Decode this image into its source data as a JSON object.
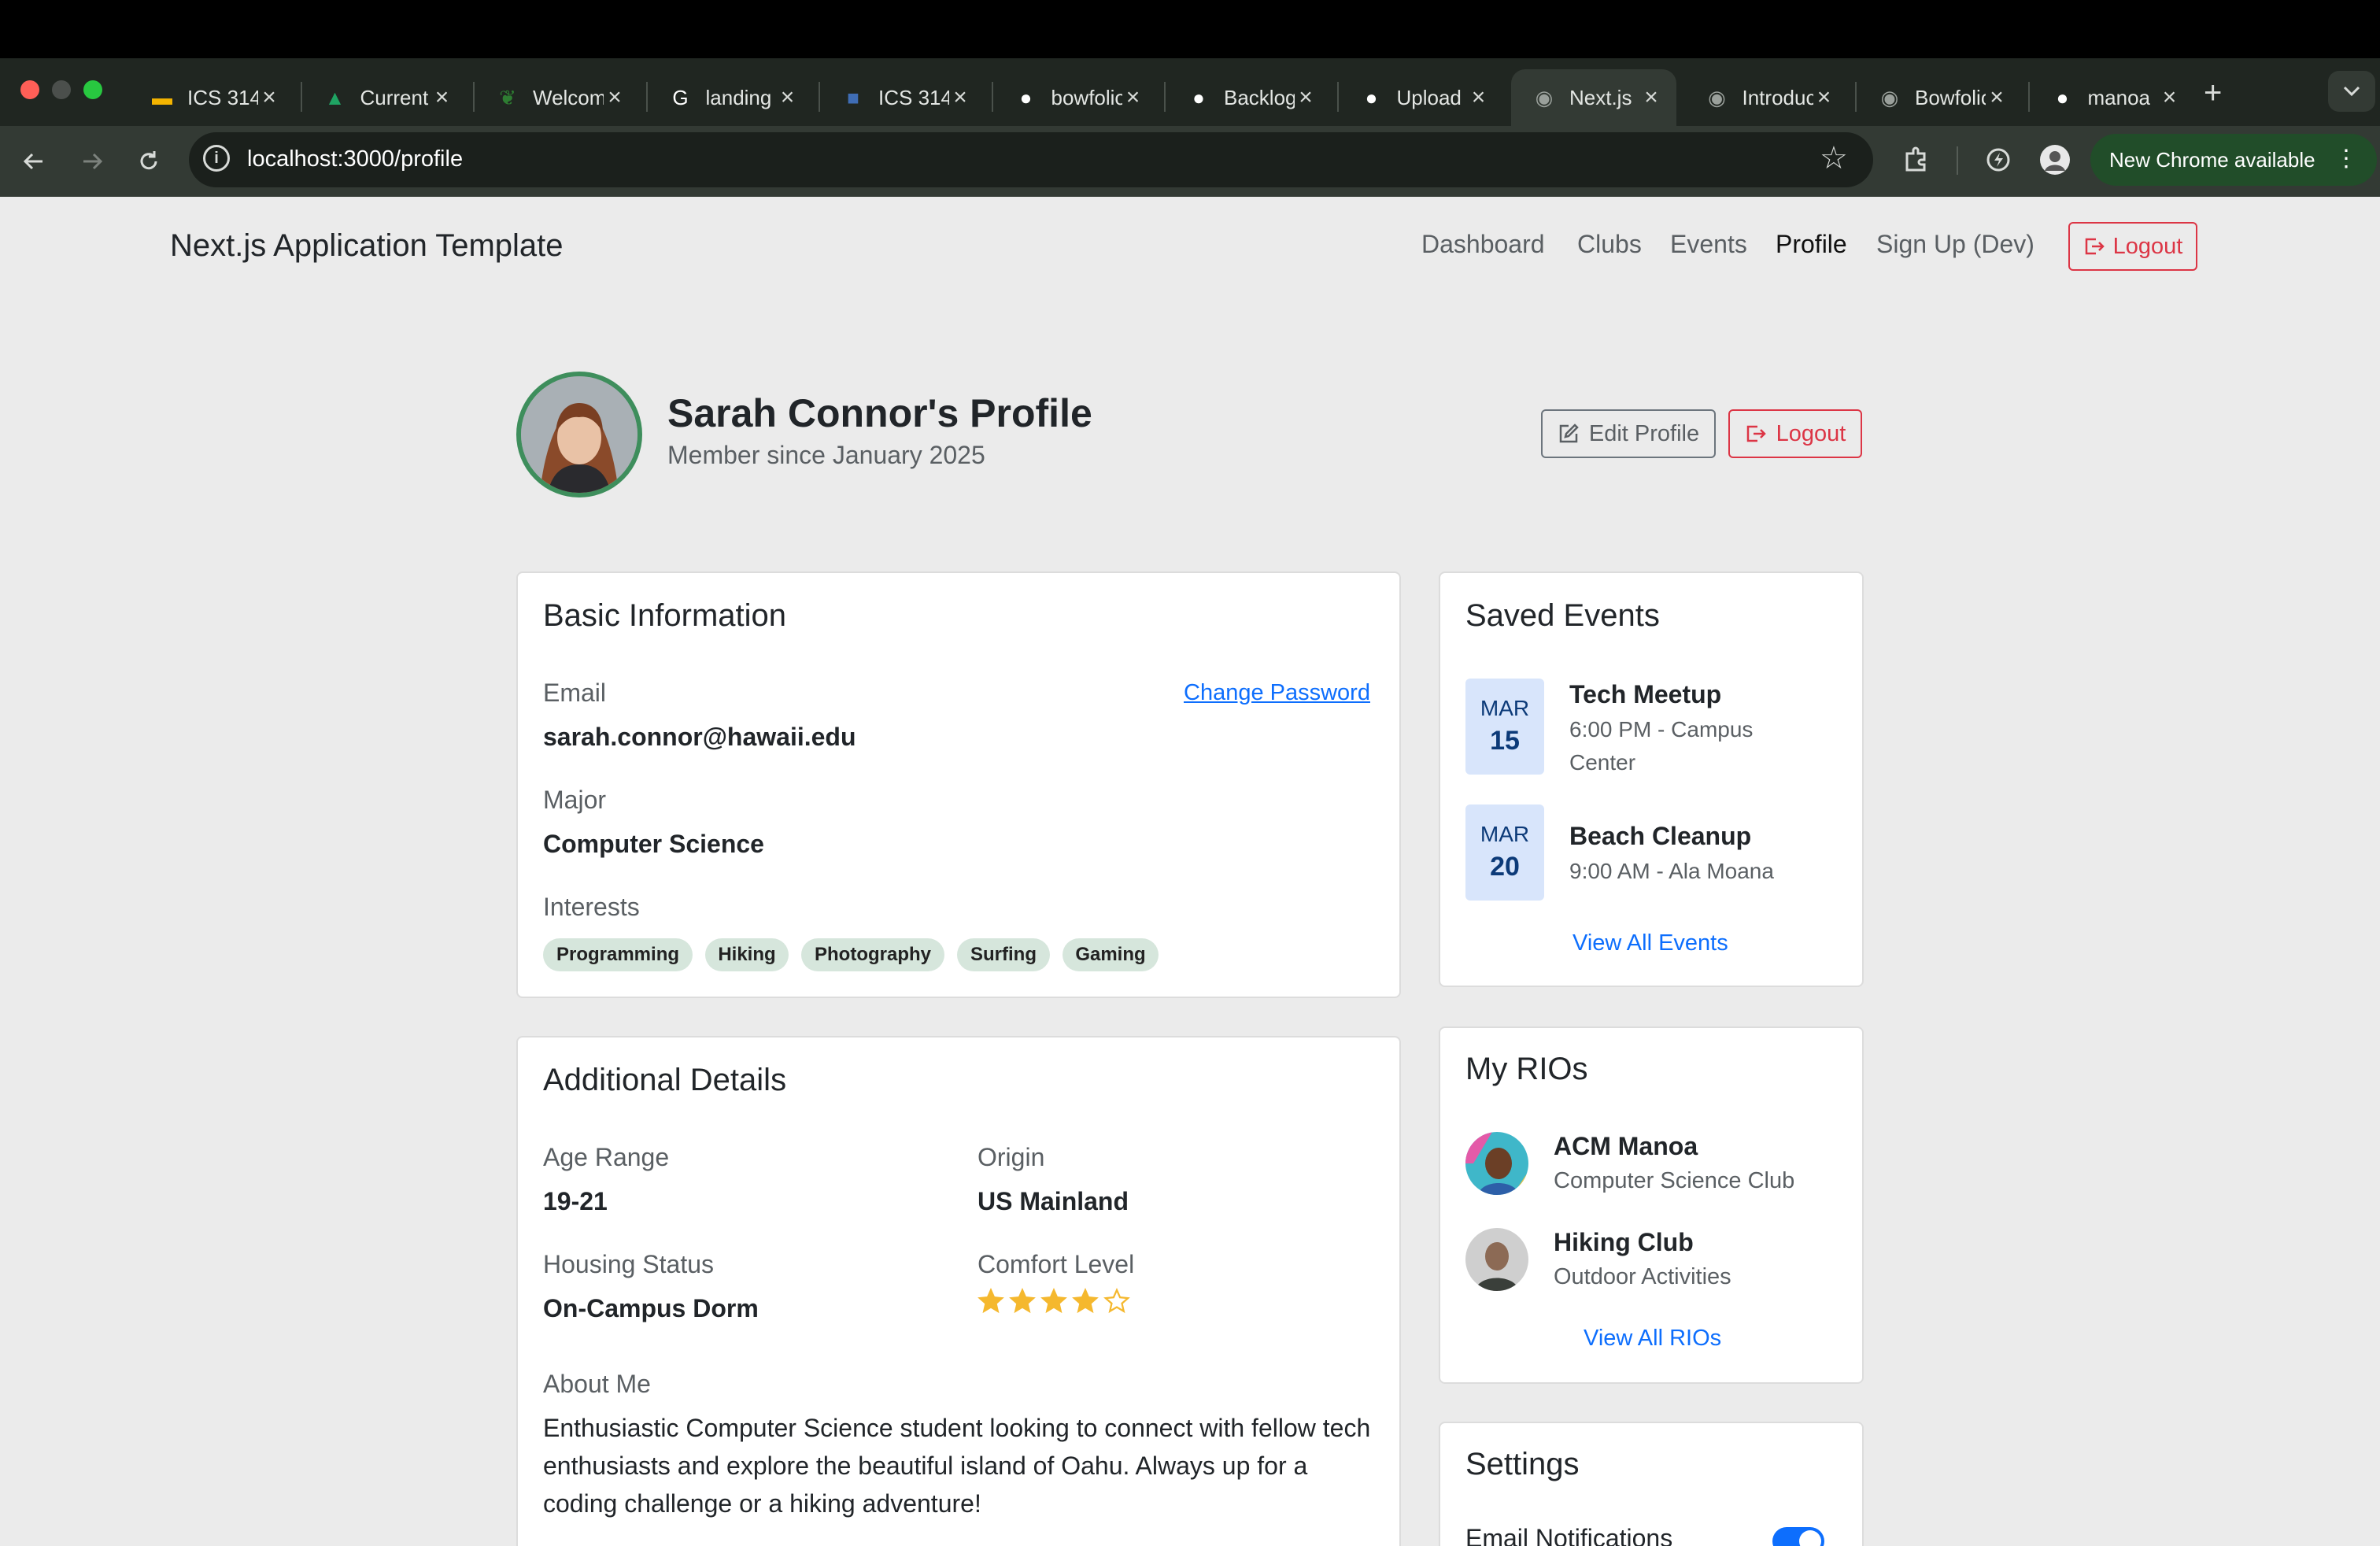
{
  "browser": {
    "tabs": [
      {
        "label": "ICS 314",
        "icon": "slides-icon",
        "color": "#f4b400"
      },
      {
        "label": "Current",
        "icon": "drive-icon",
        "color": "#1fa463"
      },
      {
        "label": "Welcome",
        "icon": "leaf-icon",
        "color": "#2e7d32"
      },
      {
        "label": "landing",
        "icon": "google-icon",
        "color": "#ffffff"
      },
      {
        "label": "ICS 314",
        "icon": "square-app-icon",
        "color": "#3f6db5"
      },
      {
        "label": "bowfolios",
        "icon": "github-icon",
        "color": "#ffffff"
      },
      {
        "label": "Backlog",
        "icon": "github-icon",
        "color": "#ffffff"
      },
      {
        "label": "Upload",
        "icon": "github-icon",
        "color": "#ffffff"
      },
      {
        "label": "Next.js",
        "icon": "globe-icon",
        "color": "#9aa09b",
        "active": true
      },
      {
        "label": "Introduction",
        "icon": "globe-icon",
        "color": "#9aa09b"
      },
      {
        "label": "Bowfolios",
        "icon": "globe-icon",
        "color": "#9aa09b"
      },
      {
        "label": "manoa",
        "icon": "github-icon",
        "color": "#ffffff"
      }
    ],
    "url": "localhost:3000/profile",
    "update_label": "New Chrome available"
  },
  "app": {
    "brand": "Next.js Application Template",
    "nav": {
      "dashboard": "Dashboard",
      "clubs": "Clubs",
      "events": "Events",
      "profile": "Profile",
      "signup": "Sign Up (Dev)",
      "logout": "Logout"
    }
  },
  "profile": {
    "name": "Sarah Connor's Profile",
    "member_since": "Member since January 2025",
    "edit_label": "Edit Profile",
    "logout_label": "Logout"
  },
  "basic_info": {
    "title": "Basic Information",
    "email_label": "Email",
    "email": "sarah.connor@hawaii.edu",
    "change_password": "Change Password",
    "major_label": "Major",
    "major": "Computer Science",
    "interests_label": "Interests",
    "interests": [
      "Programming",
      "Hiking",
      "Photography",
      "Surfing",
      "Gaming"
    ]
  },
  "additional": {
    "title": "Additional Details",
    "age_label": "Age Range",
    "age": "19-21",
    "origin_label": "Origin",
    "origin": "US Mainland",
    "housing_label": "Housing Status",
    "housing": "On-Campus Dorm",
    "comfort_label": "Comfort Level",
    "comfort_rating": 4,
    "comfort_max": 5,
    "about_label": "About Me",
    "about": "Enthusiastic Computer Science student looking to connect with fellow tech enthusiasts and explore the beautiful island of Oahu. Always up for a coding challenge or a hiking adventure!"
  },
  "saved_events": {
    "title": "Saved Events",
    "events": [
      {
        "month": "MAR",
        "day": "15",
        "title": "Tech Meetup",
        "detail": "6:00 PM - Campus Center"
      },
      {
        "month": "MAR",
        "day": "20",
        "title": "Beach Cleanup",
        "detail": "9:00 AM - Ala Moana"
      }
    ],
    "view_all": "View All Events"
  },
  "rios": {
    "title": "My RIOs",
    "items": [
      {
        "name": "ACM Manoa",
        "subtitle": "Computer Science Club"
      },
      {
        "name": "Hiking Club",
        "subtitle": "Outdoor Activities"
      }
    ],
    "view_all": "View All RIOs"
  },
  "settings": {
    "title": "Settings",
    "email_notifications": "Email Notifications",
    "email_notifications_on": true
  },
  "colors": {
    "primary": "#0d6efd",
    "danger": "#dc3545",
    "avatar_ring": "#3e8e5c",
    "chip_bg": "#d6e6dc",
    "star": "#f5b82e"
  }
}
